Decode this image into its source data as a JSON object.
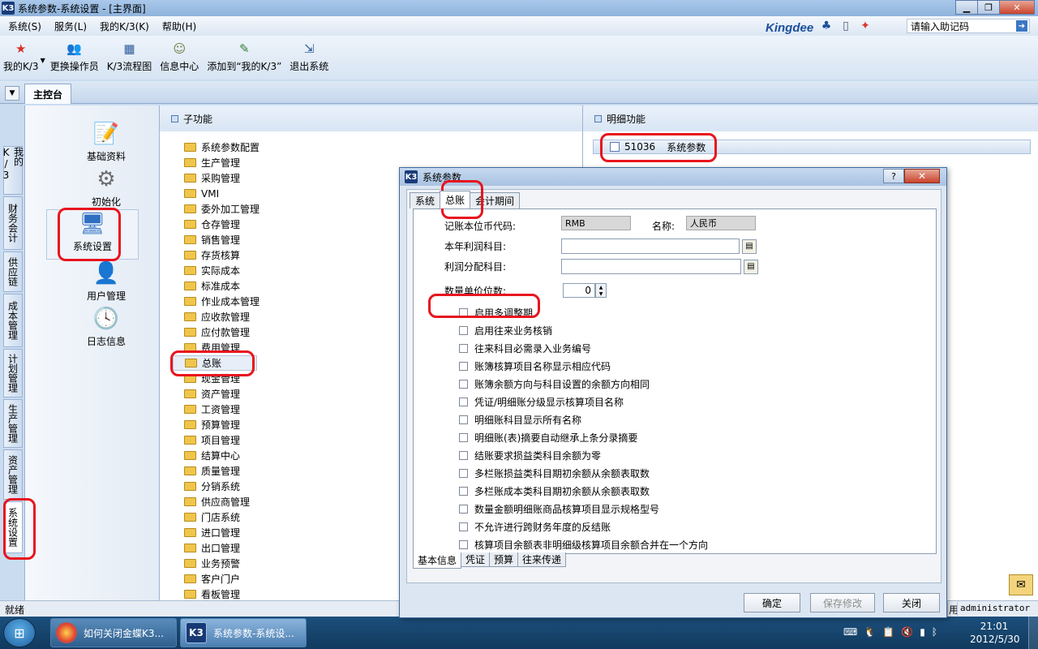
{
  "window": {
    "title": "系统参数-系统设置 - [主界面]",
    "app_icon": "K3"
  },
  "menu": [
    "系统(S)",
    "服务(L)",
    "我的K/3(K)",
    "帮助(H)"
  ],
  "brand": {
    "logo": "Kingdee",
    "help_placeholder": "请输入助记码"
  },
  "toolbar": [
    {
      "label": "我的K/3",
      "icon": "star-icon"
    },
    {
      "label": "更换操作员",
      "icon": "users-icon"
    },
    {
      "label": "K/3流程图",
      "icon": "flowchart-icon"
    },
    {
      "label": "信息中心",
      "icon": "message-icon"
    },
    {
      "label": "添加到“我的K/3”",
      "icon": "add-favorite-icon"
    },
    {
      "label": "退出系统",
      "icon": "exit-icon"
    }
  ],
  "tabstrip": {
    "active_tab": "主控台"
  },
  "vnav": [
    "我的K/3",
    "财务会计",
    "供应链",
    "成本管理",
    "计划管理",
    "生产管理",
    "资产管理",
    "系统设置"
  ],
  "functions": [
    "基础资料",
    "初始化",
    "系统设置",
    "用户管理",
    "日志信息"
  ],
  "subpanel": {
    "title": "子功能",
    "folders": [
      "系统参数配置",
      "生产管理",
      "采购管理",
      "VMI",
      "委外加工管理",
      "仓存管理",
      "销售管理",
      "存货核算",
      "实际成本",
      "标准成本",
      "作业成本管理",
      "应收款管理",
      "应付款管理",
      "费用管理",
      "总账",
      "现金管理",
      "资产管理",
      "工资管理",
      "预算管理",
      "项目管理",
      "结算中心",
      "质量管理",
      "分销系统",
      "供应商管理",
      "门店系统",
      "进口管理",
      "出口管理",
      "业务预警",
      "客户门户",
      "看板管理"
    ]
  },
  "detailpanel": {
    "title": "明细功能",
    "item_code": "51036",
    "item_name": "系统参数"
  },
  "dialog": {
    "title": "系统参数",
    "help_btn": "?",
    "close_btn": "✕",
    "tabs": [
      "系统",
      "总账",
      "会计期间"
    ],
    "fields": {
      "currency_code_label": "记账本位币代码:",
      "currency_code_value": "RMB",
      "name_label": "名称:",
      "name_value": "人民币",
      "profit_label": "本年利润科目:",
      "profit_dist_label": "利润分配科目:",
      "qty_decimals_label": "数量单价位数:",
      "qty_decimals_value": "0"
    },
    "checkboxes": [
      "启用多调整期",
      "启用往来业务核销",
      "往来科目必需录入业务编号",
      "账簿核算项目名称显示相应代码",
      "账簿余额方向与科目设置的余额方向相同",
      "凭证/明细账分级显示核算项目名称",
      "明细账科目显示所有名称",
      "明细账(表)摘要自动继承上条分录摘要",
      "结账要求损益类科目余额为零",
      "多栏账损益类科目期初余额从余额表取数",
      "多栏账成本类科目期初余额从余额表取数",
      "数量金额明细账商品核算项目显示规格型号",
      "不允许进行跨财务年度的反结账",
      "核算项目余额表非明细级核算项目余额合并在一个方向"
    ],
    "bottom_tabs": [
      "基本信息",
      "凭证",
      "预算",
      "往来传递"
    ],
    "buttons": {
      "ok": "确定",
      "save": "保存修改",
      "close": "关闭"
    }
  },
  "statusbar": {
    "status": "就绪",
    "partial": "用",
    "user": "administrator"
  },
  "taskbar": {
    "tasks": [
      "如何关闭金蝶K3...",
      "系统参数-系统设..."
    ],
    "time": "21:01",
    "date": "2012/5/30"
  },
  "colors": {
    "annotation": "#e8141e",
    "folder": "#f0c54b",
    "title_bar": "#a9c8ea"
  }
}
